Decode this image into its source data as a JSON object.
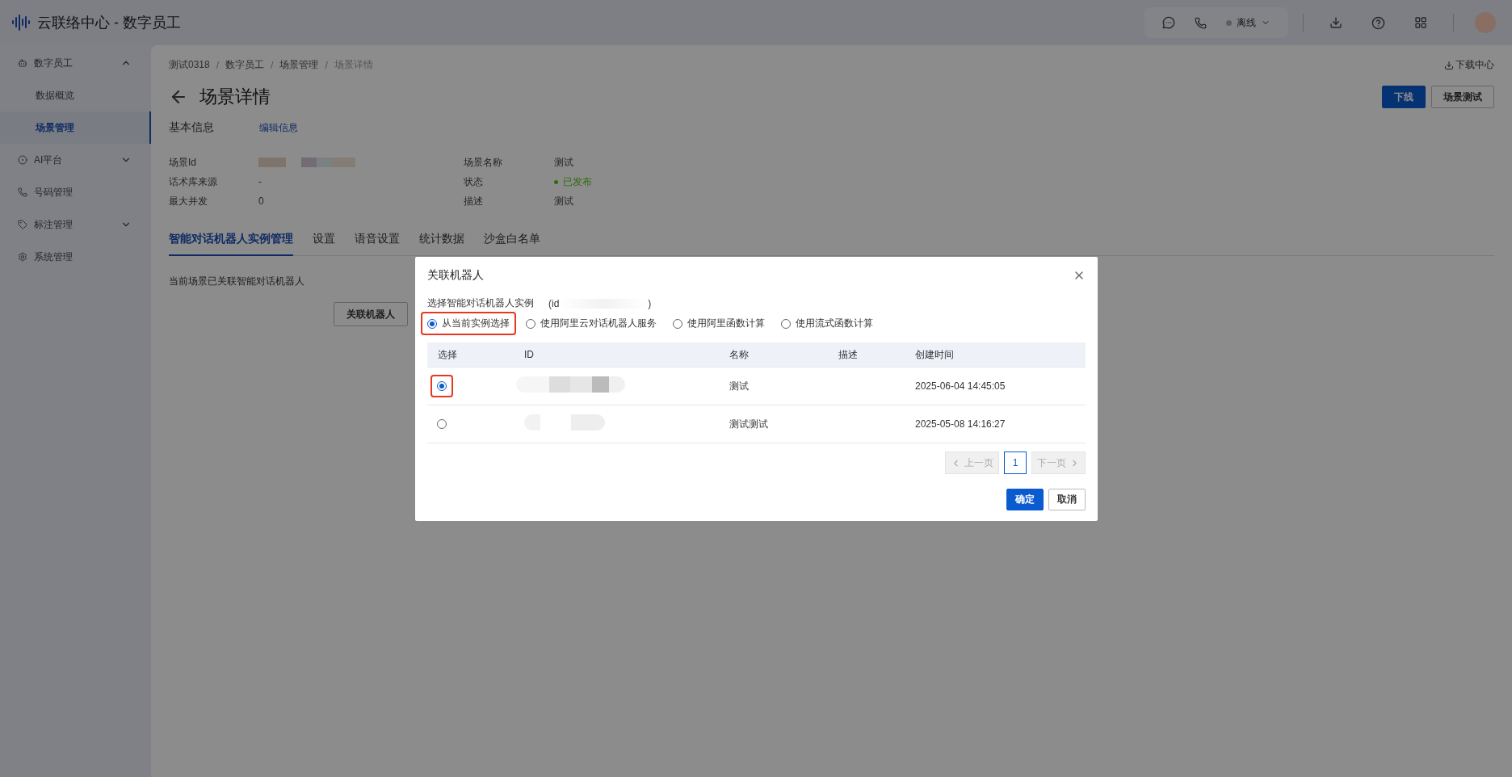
{
  "app": {
    "title": "云联络中心 - 数字员工"
  },
  "topbar": {
    "status": "离线"
  },
  "sidebar": {
    "items": [
      {
        "label": "数字员工",
        "kind": "group",
        "expanded": true,
        "children": [
          {
            "label": "数据概览",
            "selected": false
          },
          {
            "label": "场景管理",
            "selected": true
          }
        ]
      },
      {
        "label": "AI平台",
        "kind": "group",
        "expanded": false
      },
      {
        "label": "号码管理",
        "kind": "link"
      },
      {
        "label": "标注管理",
        "kind": "group",
        "expanded": false
      },
      {
        "label": "系统管理",
        "kind": "link"
      }
    ]
  },
  "breadcrumb": {
    "items": [
      "测试0318",
      "数字员工",
      "场景管理",
      "场景详情"
    ],
    "separator": "/"
  },
  "download_center": "下载中心",
  "page": {
    "title": "场景详情",
    "actions": [
      {
        "label": "下线",
        "kind": "primary"
      },
      {
        "label": "场景测试",
        "kind": "default"
      }
    ]
  },
  "basic_info": {
    "title": "基本信息",
    "edit_link": "编辑信息",
    "fields": [
      {
        "label": "场景Id",
        "kind": "redacted"
      },
      {
        "label": "场景名称",
        "value": "测试",
        "kind": "text"
      },
      {
        "label": "话术库来源",
        "value": "-",
        "kind": "text"
      },
      {
        "label": "状态",
        "value": "已发布",
        "kind": "status",
        "color": "#2d6c0e"
      },
      {
        "label": "最大并发",
        "value": "0",
        "kind": "text"
      },
      {
        "label": "描述",
        "value": "测试",
        "kind": "text"
      }
    ]
  },
  "tabs": [
    {
      "label": "智能对话机器人实例管理",
      "selected": true
    },
    {
      "label": "设置",
      "selected": false
    },
    {
      "label": "语音设置",
      "selected": false
    },
    {
      "label": "统计数据",
      "selected": false
    },
    {
      "label": "沙盒白名单",
      "selected": false
    }
  ],
  "tab_content": {
    "text": "当前场景已关联智能对话机器人",
    "button": "关联机器人"
  },
  "dialog": {
    "title": "关联机器人",
    "hint": "选择智能对话机器人实例",
    "hint_id_prefix": "(id",
    "hint_id_suffix": ")",
    "sources": [
      {
        "label": "从当前实例选择",
        "selected": true,
        "annotated": true
      },
      {
        "label": "使用阿里云对话机器人服务",
        "selected": false,
        "annotated": false
      },
      {
        "label": "使用阿里函数计算",
        "selected": false,
        "annotated": false
      },
      {
        "label": "使用流式函数计算",
        "selected": false,
        "annotated": false
      }
    ],
    "table": {
      "columns": [
        "选择",
        "ID",
        "名称",
        "描述",
        "创建时间"
      ],
      "rows": [
        {
          "selected": true,
          "annotated": true,
          "name": "测试",
          "created": "2025-06-04 14:45:05"
        },
        {
          "selected": false,
          "annotated": false,
          "name": "测试测试",
          "created": "2025-05-08 14:16:27"
        }
      ]
    },
    "pagination": {
      "prev": "上一页",
      "page": "1",
      "next": "下一页"
    },
    "buttons": [
      {
        "label": "确定",
        "kind": "primary"
      },
      {
        "label": "取消",
        "kind": "default"
      }
    ]
  }
}
